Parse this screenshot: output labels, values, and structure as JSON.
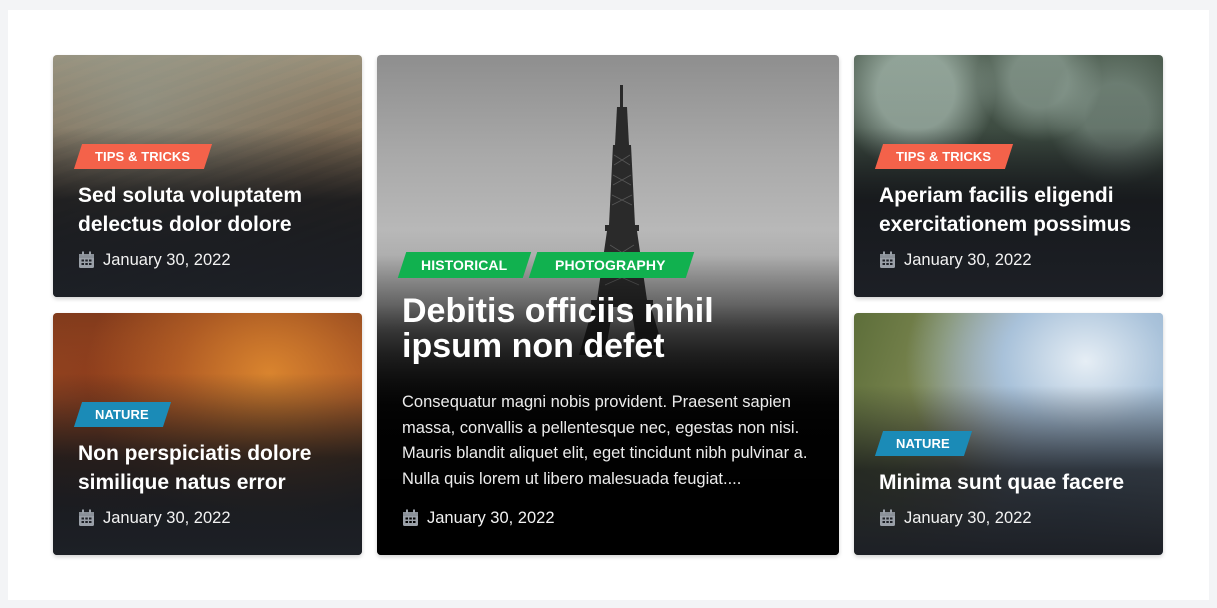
{
  "colors": {
    "tips": "#f4624a",
    "nature": "#1b8bb7",
    "green": "#11b14f"
  },
  "cards": [
    {
      "tags": [
        "TIPS & TRICKS"
      ],
      "title": "Sed soluta voluptatem delectus dolor dolore",
      "date": "January 30, 2022"
    },
    {
      "tags": [
        "NATURE"
      ],
      "title": "Non perspiciatis dolore similique natus error",
      "date": "January 30, 2022"
    },
    {
      "tags": [
        "HISTORICAL",
        "PHOTOGRAPHY"
      ],
      "title": "Debitis officiis nihil ipsum non defet",
      "excerpt": "Consequatur magni nobis provident. Praesent sapien massa, convallis a pellentesque nec, egestas non nisi. Mauris blandit aliquet elit, eget tincidunt nibh pulvinar a. Nulla quis lorem ut libero malesuada feugiat....",
      "date": "January 30, 2022"
    },
    {
      "tags": [
        "TIPS & TRICKS"
      ],
      "title": "Aperiam facilis eligendi exercitationem possimus",
      "date": "January 30, 2022"
    },
    {
      "tags": [
        "NATURE"
      ],
      "title": "Minima sunt quae facere",
      "date": "January 30, 2022"
    }
  ],
  "icons": {
    "date": "calendar-icon"
  }
}
